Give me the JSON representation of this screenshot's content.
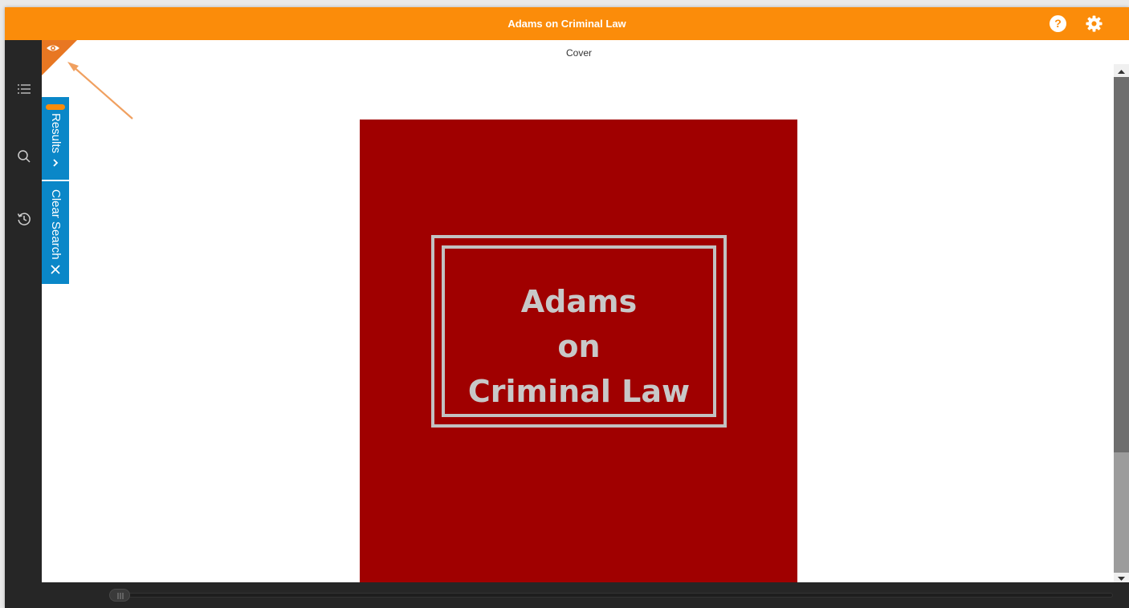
{
  "header": {
    "title": "Adams on Criminal Law",
    "help_label": "?"
  },
  "sidebar": {
    "icons": [
      "table-of-contents-icon",
      "search-icon",
      "history-icon"
    ]
  },
  "tabs": {
    "results_label": "Results",
    "clear_search_label": "Clear Search"
  },
  "page": {
    "label": "Cover",
    "cover_title_line1": "Adams",
    "cover_title_line2": "on",
    "cover_title_line3": "Criminal Law"
  },
  "colors": {
    "accent": "#fb8c0a",
    "tab_blue": "#0a87c8",
    "cover_red": "#a00000",
    "sidebar": "#262626"
  }
}
